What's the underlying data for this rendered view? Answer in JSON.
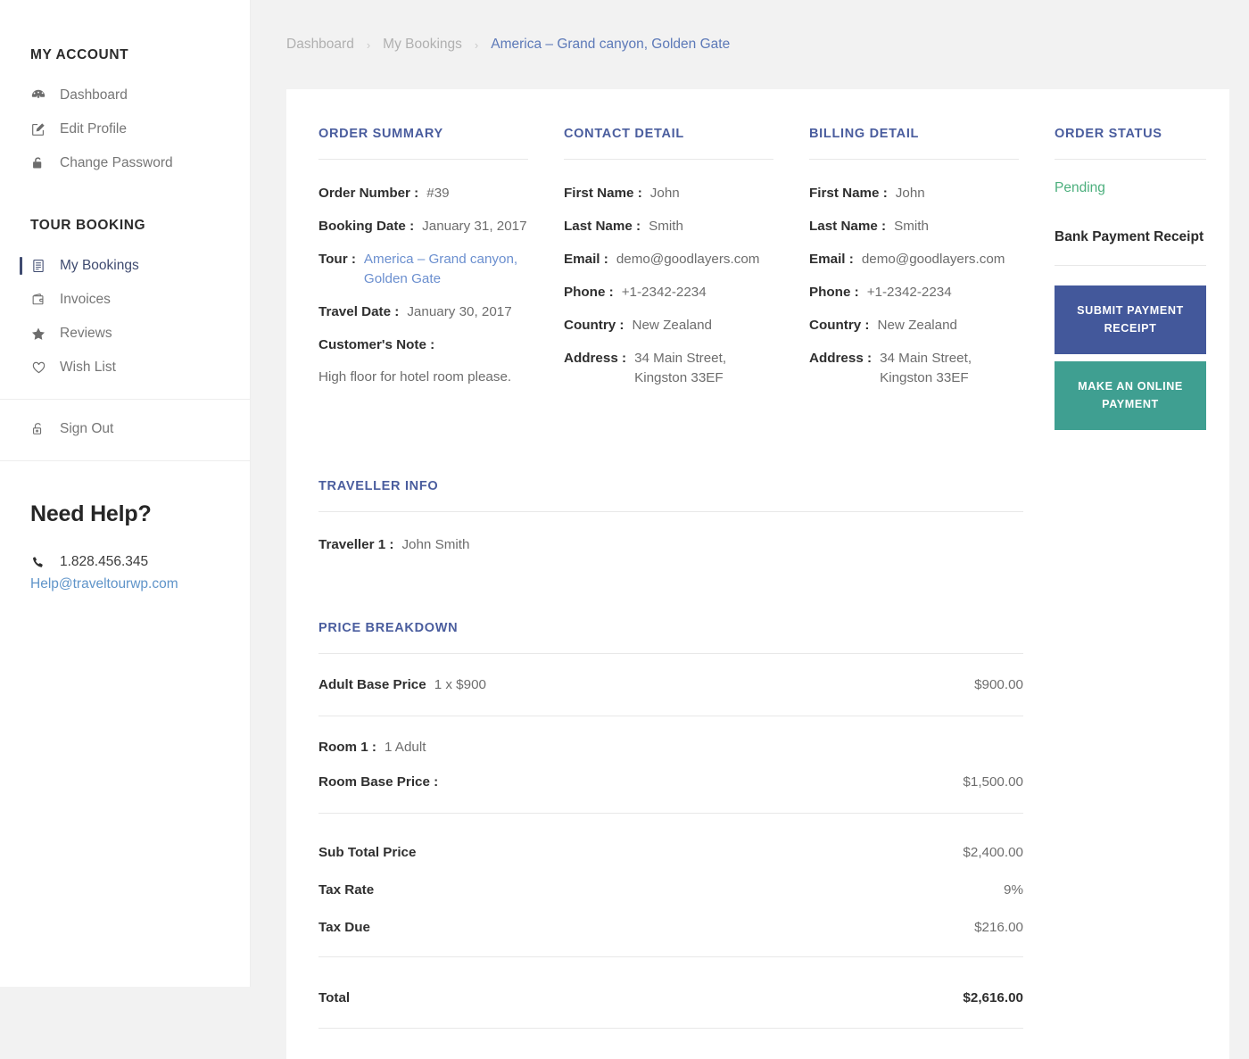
{
  "sidebar": {
    "account_title": "MY ACCOUNT",
    "account_items": [
      {
        "label": "Dashboard",
        "icon": "dashboard-icon"
      },
      {
        "label": "Edit Profile",
        "icon": "edit-profile-icon"
      },
      {
        "label": "Change Password",
        "icon": "lock-icon"
      }
    ],
    "booking_title": "TOUR BOOKING",
    "booking_items": [
      {
        "label": "My Bookings",
        "icon": "document-icon",
        "active": true
      },
      {
        "label": "Invoices",
        "icon": "wallet-icon",
        "active": false
      },
      {
        "label": "Reviews",
        "icon": "star-icon",
        "active": false
      },
      {
        "label": "Wish List",
        "icon": "heart-icon",
        "active": false
      }
    ],
    "signout": {
      "label": "Sign Out",
      "icon": "unlock-icon"
    },
    "help": {
      "title": "Need Help?",
      "phone_icon": "phone-icon",
      "phone": "1.828.456.345",
      "email": "Help@traveltourwp.com"
    }
  },
  "breadcrumb": {
    "dashboard": "Dashboard",
    "my_bookings": "My Bookings",
    "separator": "›",
    "current": "America – Grand canyon, Golden Gate"
  },
  "order_summary": {
    "heading": "ORDER SUMMARY",
    "order_number_label": "Order Number :",
    "order_number": "#39",
    "booking_date_label": "Booking Date :",
    "booking_date": "January 31, 2017",
    "tour_label": "Tour :",
    "tour": "America – Grand canyon, Golden Gate",
    "travel_date_label": "Travel Date :",
    "travel_date": "January 30, 2017",
    "note_label": "Customer's Note :",
    "note": "High floor for hotel room please."
  },
  "contact_detail": {
    "heading": "CONTACT DETAIL",
    "first_name_label": "First Name :",
    "first_name": "John",
    "last_name_label": "Last Name :",
    "last_name": "Smith",
    "email_label": "Email :",
    "email": "demo@goodlayers.com",
    "phone_label": "Phone :",
    "phone": "+1-2342-2234",
    "country_label": "Country :",
    "country": "New Zealand",
    "address_label": "Address :",
    "address": "34 Main Street, Kingston 33EF"
  },
  "billing_detail": {
    "heading": "BILLING DETAIL",
    "first_name_label": "First Name :",
    "first_name": "John",
    "last_name_label": "Last Name :",
    "last_name": "Smith",
    "email_label": "Email :",
    "email": "demo@goodlayers.com",
    "phone_label": "Phone :",
    "phone": "+1-2342-2234",
    "country_label": "Country :",
    "country": "New Zealand",
    "address_label": "Address :",
    "address": "34 Main Street, Kingston 33EF"
  },
  "order_status": {
    "heading": "ORDER STATUS",
    "status": "Pending",
    "status_color": "#4caf7d",
    "receipt_label": "Bank Payment Receipt",
    "submit_button": "SUBMIT PAYMENT RECEIPT",
    "submit_button_color": "#43589b",
    "online_button": "MAKE AN ONLINE PAYMENT",
    "online_button_color": "#3f9f91"
  },
  "traveller_info": {
    "heading": "TRAVELLER INFO",
    "traveller_label": "Traveller 1 :",
    "traveller_name": "John Smith"
  },
  "price_breakdown": {
    "heading": "PRICE BREAKDOWN",
    "adult_label": "Adult Base Price",
    "adult_qty": "1 x $900",
    "adult_value": "$900.00",
    "room_label": "Room 1 :",
    "room_occupancy": "1 Adult",
    "room_price_label": "Room Base Price :",
    "room_price_value": "$1,500.00",
    "subtotal_label": "Sub Total Price",
    "subtotal_value": "$2,400.00",
    "tax_rate_label": "Tax Rate",
    "tax_rate_value": "9%",
    "tax_due_label": "Tax Due",
    "tax_due_value": "$216.00",
    "total_label": "Total",
    "total_value": "$2,616.00"
  }
}
